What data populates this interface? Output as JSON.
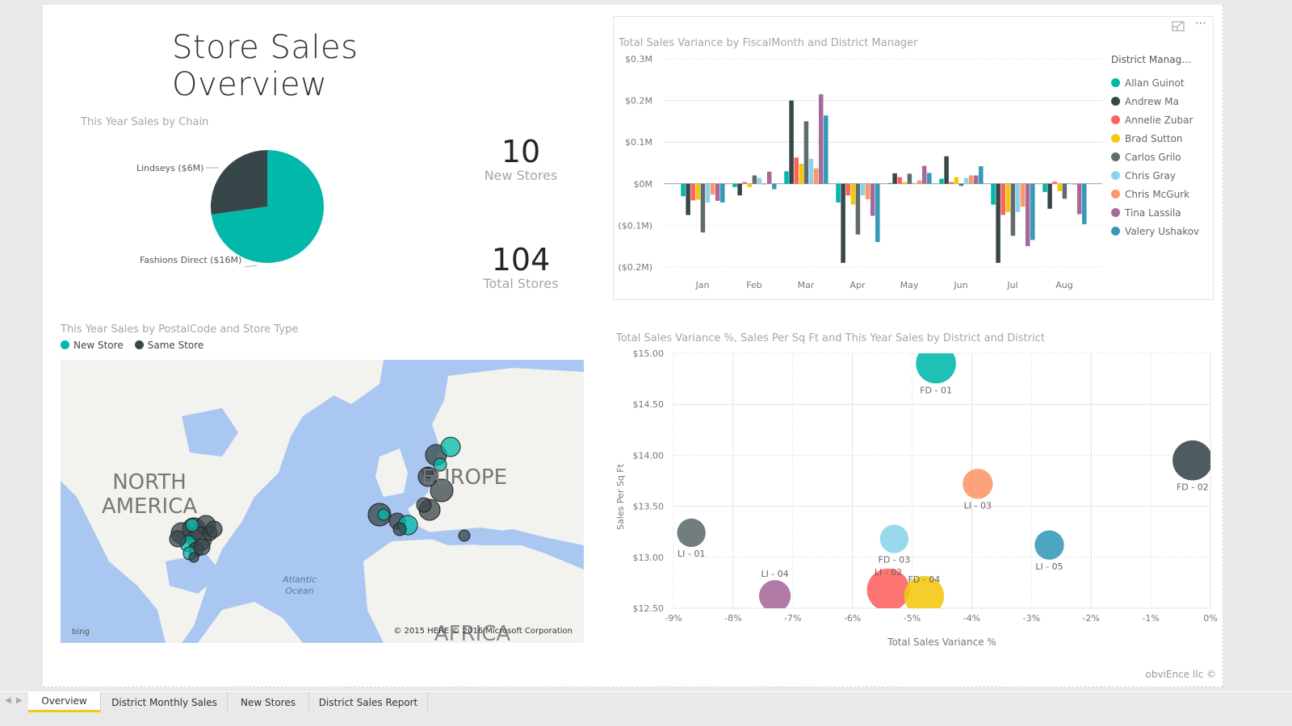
{
  "report": {
    "title": "Store Sales Overview",
    "credit": "obviEnce llc ©"
  },
  "kpis": [
    {
      "value": "10",
      "label": "New Stores"
    },
    {
      "value": "104",
      "label": "Total Stores"
    }
  ],
  "bar_header_icons": {
    "focus": "focus-mode-icon",
    "more": "more-options-icon",
    "more_glyph": "⋯"
  },
  "map": {
    "title": "This Year Sales by PostalCode and Store Type",
    "legend": [
      {
        "label": "New Store",
        "color": "#01b8aa"
      },
      {
        "label": "Same Store",
        "color": "#374649"
      }
    ],
    "labels": {
      "north_america": [
        "NORTH",
        "AMERICA"
      ],
      "europe": "EUROPE",
      "africa": "AFRICA",
      "ocean": [
        "Atlantic",
        "Ocean"
      ]
    },
    "bing": "bing",
    "copyright": "© 2015 HERE  © 2016 Microsoft Corporation"
  },
  "tabs": {
    "items": [
      {
        "label": "Overview",
        "active": true
      },
      {
        "label": "District Monthly Sales",
        "active": false
      },
      {
        "label": "New Stores",
        "active": false
      },
      {
        "label": "District Sales Report",
        "active": false
      }
    ],
    "prev": "◀",
    "next": "▶"
  },
  "chart_data": [
    {
      "type": "pie",
      "title": "This Year Sales by Chain",
      "categories": [
        "Fashions Direct",
        "Lindseys"
      ],
      "values": [
        16,
        6
      ],
      "unit": "$M",
      "data_labels": [
        "Fashions Direct ($16M)",
        "Lindseys ($6M)"
      ],
      "colors": [
        "#01b8aa",
        "#374649"
      ]
    },
    {
      "type": "bar",
      "title": "Total Sales Variance by FiscalMonth and District Manager",
      "categories": [
        "Jan",
        "Feb",
        "Mar",
        "Apr",
        "May",
        "Jun",
        "Jul",
        "Aug"
      ],
      "ylabel": "",
      "xlabel": "",
      "ylim": [
        -0.2,
        0.3
      ],
      "yticks": [
        0.3,
        0.2,
        0.1,
        0,
        -0.1,
        -0.2
      ],
      "ytick_labels": [
        "$0.3M",
        "$0.2M",
        "$0.1M",
        "$0M",
        "($0.1M)",
        "($0.2M)"
      ],
      "legend_title": "District Manag...",
      "legend_position": "right",
      "series": [
        {
          "name": "Allan Guinot",
          "color": "#01b8aa",
          "values": [
            -0.03,
            -0.008,
            0.03,
            -0.045,
            0.002,
            0.012,
            -0.05,
            -0.02
          ]
        },
        {
          "name": "Andrew Ma",
          "color": "#374649",
          "values": [
            -0.075,
            -0.028,
            0.2,
            -0.19,
            0.025,
            0.066,
            -0.19,
            -0.06
          ]
        },
        {
          "name": "Annelie Zubar",
          "color": "#fd625e",
          "values": [
            -0.04,
            0.004,
            0.063,
            -0.028,
            0.016,
            0.004,
            -0.075,
            0.005
          ]
        },
        {
          "name": "Brad Sutton",
          "color": "#f2c80f",
          "values": [
            -0.038,
            -0.008,
            0.048,
            -0.05,
            0.004,
            0.016,
            -0.068,
            -0.018
          ]
        },
        {
          "name": "Carlos Grilo",
          "color": "#5f6b6d",
          "values": [
            -0.117,
            0.02,
            0.15,
            -0.122,
            0.024,
            -0.005,
            -0.125,
            -0.036
          ]
        },
        {
          "name": "Chris Gray",
          "color": "#8ad4eb",
          "values": [
            -0.045,
            0.014,
            0.06,
            -0.028,
            0.002,
            0.014,
            -0.068,
            0.002
          ]
        },
        {
          "name": "Chris McGurk",
          "color": "#fe9666",
          "values": [
            -0.026,
            -0.001,
            0.037,
            -0.037,
            0.008,
            0.02,
            -0.055,
            -0.002
          ]
        },
        {
          "name": "Tina Lassila",
          "color": "#a66999",
          "values": [
            -0.041,
            0.029,
            0.215,
            -0.077,
            0.043,
            0.02,
            -0.15,
            -0.073
          ]
        },
        {
          "name": "Valery Ushakov",
          "color": "#3599b8",
          "values": [
            -0.045,
            -0.013,
            0.164,
            -0.14,
            0.026,
            0.042,
            -0.135,
            -0.097
          ]
        }
      ]
    },
    {
      "type": "scatter",
      "title": "Total Sales Variance %, Sales Per Sq Ft and This Year Sales by District and District",
      "xlabel": "Total Sales Variance %",
      "ylabel": "Sales Per Sq Ft",
      "xlim": [
        -9,
        0
      ],
      "ylim": [
        12.5,
        15.0
      ],
      "xticks": [
        -9,
        -8,
        -7,
        -6,
        -5,
        -4,
        -3,
        -2,
        -1,
        0
      ],
      "xtick_labels": [
        "-9%",
        "-8%",
        "-7%",
        "-6%",
        "-5%",
        "-4%",
        "-3%",
        "-2%",
        "-1%",
        "0%"
      ],
      "yticks": [
        15.0,
        14.5,
        14.0,
        13.5,
        13.0,
        12.5
      ],
      "ytick_labels": [
        "$15.00",
        "$14.50",
        "$14.00",
        "$13.50",
        "$13.00",
        "$12.50"
      ],
      "grid": true,
      "points": [
        {
          "label": "FD - 01",
          "x": -4.6,
          "y": 14.9,
          "size": 3.0,
          "color": "#01b8aa"
        },
        {
          "label": "FD - 02",
          "x": -0.3,
          "y": 13.95,
          "size": 3.0,
          "color": "#374649"
        },
        {
          "label": "LI - 03",
          "x": -3.9,
          "y": 13.72,
          "size": 1.5,
          "color": "#fe9666"
        },
        {
          "label": "LI - 01",
          "x": -8.7,
          "y": 13.24,
          "size": 1.3,
          "color": "#5f6b6d"
        },
        {
          "label": "FD - 03",
          "x": -5.3,
          "y": 13.18,
          "size": 1.3,
          "color": "#8ad4eb"
        },
        {
          "label": "LI - 05",
          "x": -2.7,
          "y": 13.12,
          "size": 1.4,
          "color": "#3599b8"
        },
        {
          "label": "LI - 04",
          "x": -7.3,
          "y": 12.62,
          "size": 1.7,
          "color": "#a66999"
        },
        {
          "label": "LI - 02",
          "x": -5.4,
          "y": 12.68,
          "size": 3.5,
          "color": "#fd625e"
        },
        {
          "label": "FD - 04",
          "x": -4.8,
          "y": 12.62,
          "size": 3.0,
          "color": "#f2c80f"
        }
      ]
    }
  ]
}
